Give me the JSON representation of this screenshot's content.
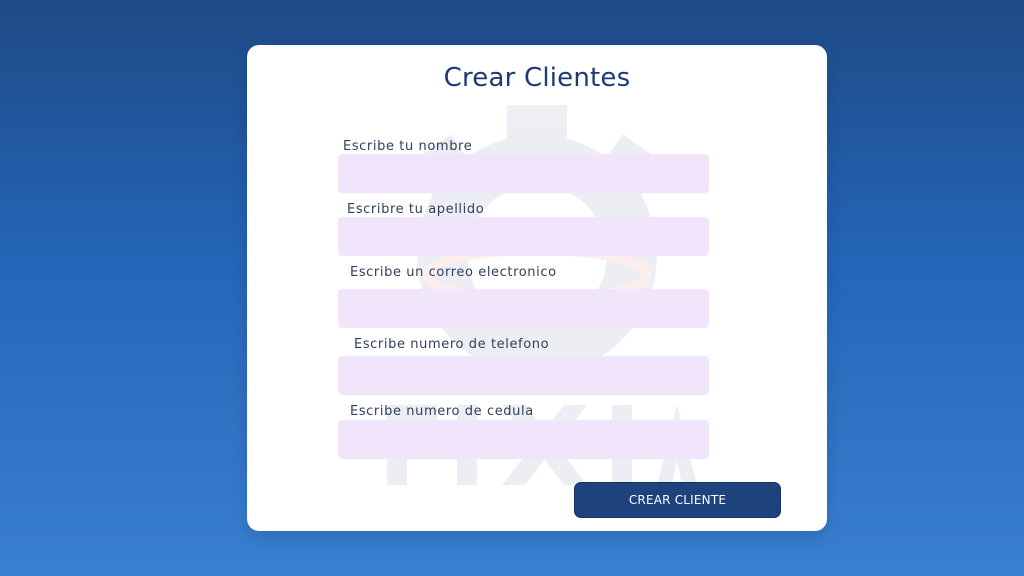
{
  "form": {
    "title": "Crear Clientes",
    "fields": [
      {
        "label": "Escribe tu nombre",
        "value": "",
        "placeholder": ""
      },
      {
        "label": "Escribre tu apellido",
        "value": "",
        "placeholder": ""
      },
      {
        "label": "Escribe un correo electronico",
        "value": "",
        "placeholder": ""
      },
      {
        "label": "Escribe numero de telefono",
        "value": "",
        "placeholder": ""
      },
      {
        "label": "Escribe numero de cedula",
        "value": "",
        "placeholder": ""
      }
    ],
    "submit_label": "CREAR CLIENTE"
  },
  "colors": {
    "background_top": "#1f4a86",
    "background_bottom": "#3a80d0",
    "card": "#ffffff",
    "title": "#1d3a74",
    "input_fill": "#f1e5fb",
    "button": "#1e427e"
  },
  "icons": {
    "watermark": "gear-logo-icon"
  }
}
